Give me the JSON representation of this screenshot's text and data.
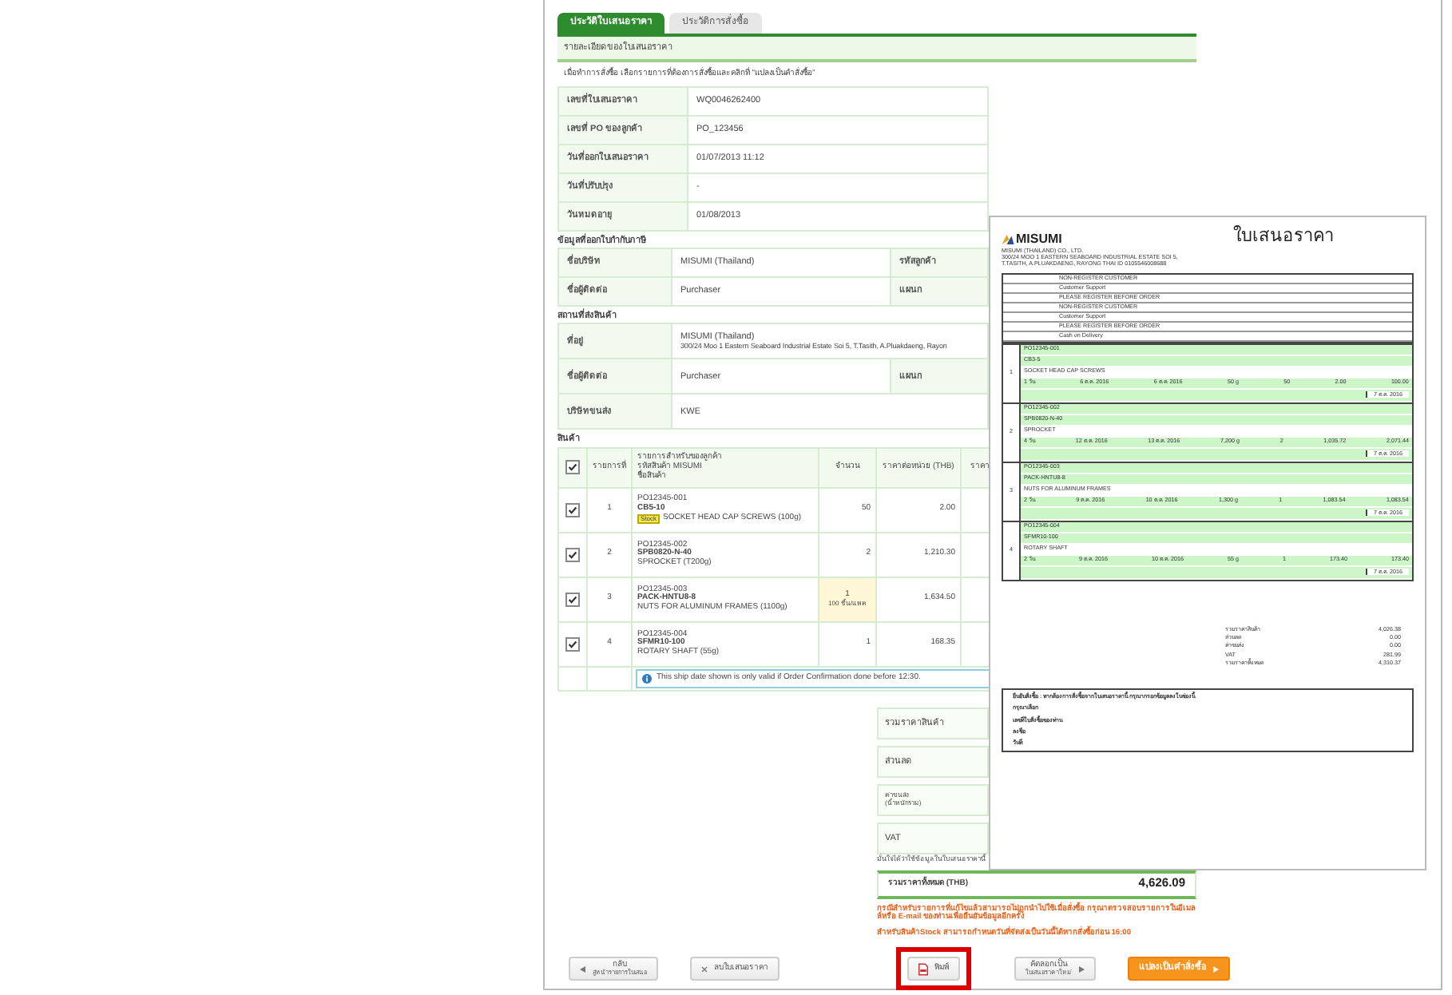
{
  "tabs": [
    {
      "label": "ประวัติใบเสนอราคา",
      "selected": true
    },
    {
      "label": "ประวัติการสั่งซื้อ",
      "selected": false
    }
  ],
  "section_title": "รายละเอียดของใบเสนอราคา",
  "note": "เมื่อทำการสั่งซื้อ เลือกรายการที่ต้องการสั่งซื้อและคลิกที่ \"แปลงเป็นคำสั่งซื้อ\"",
  "quote_info": [
    {
      "label": "เลขที่ใบเสนอราคา",
      "value": "WQ0046262400"
    },
    {
      "label": "เลขที่ PO ของลูกค้า",
      "value": "PO_123456"
    },
    {
      "label": "วันที่ออกใบเสนอราคา",
      "value": "01/07/2013 11:12"
    },
    {
      "label": "วันที่ปรับปรุง",
      "value": "-"
    },
    {
      "label": "วันหมดอายุ",
      "value": "01/08/2013"
    }
  ],
  "billing": {
    "title": "ข้อมูลที่ออกใบกำกับภาษี",
    "rows": [
      {
        "label": "ชื่อบริษัท",
        "value": "MISUMI (Thailand)",
        "label_2": "รหัสลูกค้า"
      },
      {
        "label": "ชื่อผู้ติดต่อ",
        "value": "Purchaser",
        "label_2": "แผนก"
      }
    ]
  },
  "shipping": {
    "title": "สถานที่ส่งสินค้า",
    "rows": [
      {
        "label": "ที่อยู่",
        "lines": [
          "MISUMI (Thailand)",
          "300/24 Moo 1 Eastern Seaboard Industrial Estate Soi 5, T.Tasith, A.Pluakdaeng, Rayon"
        ]
      },
      {
        "label": "ชื่อผู้ติดต่อ",
        "lines": [
          "Purchaser"
        ],
        "label_2": "แผนก"
      },
      {
        "label": "บริษัทขนส่ง",
        "lines": [
          "KWE"
        ]
      }
    ]
  },
  "products": {
    "title": "สินค้า",
    "header_checked": true,
    "columns": [
      "รายการที่",
      [
        "รายการสำหรับของลูกค้า",
        "รหัสสินค้า MISUMI",
        "ชื่อสินค้า"
      ],
      "จำนวน",
      "ราคาต่อหน่วย (THB)",
      "ราคา"
    ],
    "rows": [
      {
        "checked": true,
        "no": "1",
        "po": "PO12345-001",
        "code": "CB5-10",
        "badge": "Stock",
        "name": "SOCKET HEAD CAP SCREWS (100g)",
        "qty": "50",
        "unit_price": "2.00"
      },
      {
        "checked": true,
        "no": "2",
        "po": "PO12345-002",
        "code": "SPB0820-N-40",
        "name": "SPROCKET (T200g)",
        "qty": "2",
        "unit_price": "1,210.30"
      },
      {
        "checked": true,
        "no": "3",
        "po": "PO12345-003",
        "code": "PACK-HNTU8-8",
        "name": "NUTS FOR ALUMINUM FRAMES (1100g)",
        "qty": "1",
        "qty_note": "100 ชิ้น/แพค",
        "unit_price": "1,634.50"
      },
      {
        "checked": true,
        "no": "4",
        "po": "PO12345-004",
        "code": "SFMR10-100",
        "name": "ROTARY SHAFT (55g)",
        "qty": "1",
        "unit_price": "168.35"
      }
    ],
    "info": "This ship date shown is only valid if Order Confirmation done before 12:30."
  },
  "summary": [
    {
      "lines": [
        "รวมราคาสินค้า"
      ]
    },
    {
      "lines": [
        "ส่วนลด"
      ]
    },
    {
      "lines": [
        "ค่าขนส่ง",
        "(น้ำหนักรวม)"
      ]
    },
    {
      "lines": [
        "VAT"
      ]
    }
  ],
  "summary_note": "มั่นใจได้ว่าใช้ข้อมูลในใบเสนอราคานี้",
  "total": {
    "label": "รวมราคาทั้งหมด (THB)",
    "value": "4,626.09"
  },
  "warnings": [
    "กรณีสำหรับรายการที่แก้ไขแล้วสามารถไม่ถูกนำไปใช้เมื่อสั่งซื้อ กรุณาตรวจสอบรายการในอีเมลล์หรือ E-mail ของท่านเพื่อยืนยันข้อมูลอีกครั้ง",
    "สำหรับสินค้าStock สามารถกำหนดวันที่จัดส่งเป็นวันนี้ได้หากสั่งซื้อก่อน 16:00"
  ],
  "buttons": [
    {
      "kind": "back",
      "label": "กลับ",
      "sub": "สู่หน้ารายการใบเสนอ"
    },
    {
      "kind": "delete",
      "label": "ลบใบเสนอราคา"
    },
    {
      "kind": "print",
      "label": "พิมพ์",
      "highlighted": true
    },
    {
      "kind": "copy",
      "label": "คัดลอกเป็น",
      "sub": "ใบเสนอราคาใหม่"
    },
    {
      "kind": "convert",
      "label": "แปลงเป็นคำสั่งซื้อ"
    }
  ],
  "preview": {
    "title": "ใบเสนอราคา",
    "logo": "MISUMI",
    "company": [
      "MISUMI (THAILAND) CO., LTD.",
      "300/24 MOO 1 EASTERN SEABOARD INDUSTRIAL ESTATE SOI 5,",
      "T.TASITH, A.PLUAKDAENG, RAYONG THAI ID 0105546008688"
    ],
    "customer_rows": [
      "NON-REGISTER CUSTOMER",
      "Customer Support",
      "PLEASE REGISTER BEFORE ORDER",
      "NON-REGISTER CUSTOMER",
      "Customer Support",
      "PLEASE REGISTER BEFORE ORDER",
      "Cash on Delivery"
    ],
    "items": [
      {
        "no": "1",
        "po": "PO12345-001",
        "code": "CB3-5",
        "name": "SOCKET HEAD CAP SCREWS",
        "cells": [
          "1 วัน",
          "6 ต.ค. 2016",
          "6 ต.ค. 2016",
          "50 g",
          "50",
          "2.00",
          "100.00"
        ],
        "ship": "7 ต.ค. 2016"
      },
      {
        "no": "2",
        "po": "PO12345-002",
        "code": "SPB0820-N-40",
        "name": "SPROCKET",
        "cells": [
          "4 วัน",
          "12 ต.ค. 2016",
          "13 ต.ค. 2016",
          "7,200 g",
          "2",
          "1,035.72",
          "2,071.44"
        ],
        "ship": "7 ต.ค. 2016"
      },
      {
        "no": "3",
        "po": "PO12345-003",
        "code": "PACK-HNTU8-8",
        "name": "NUTS FOR ALUMINUM FRAMES",
        "cells": [
          "2 วัน",
          "9 ต.ค. 2016",
          "10 ต.ค. 2016",
          "1,300 g",
          "1",
          "1,083.54",
          "1,083.54"
        ],
        "ship": "7 ต.ค. 2016"
      },
      {
        "no": "4",
        "po": "PO12345-004",
        "code": "SFMR10-100",
        "name": "ROTARY SHAFT",
        "cells": [
          "2 วัน",
          "9 ต.ค. 2016",
          "10 ต.ค. 2016",
          "55 g",
          "1",
          "173.40",
          "173.40"
        ],
        "ship": "7 ต.ค. 2016"
      }
    ],
    "totals": [
      {
        "label": "รวมราคาสินค้า",
        "value": "4,026.38"
      },
      {
        "label": "ส่วนลด",
        "value": "0.00"
      },
      {
        "label": "ค่าขนส่ง",
        "value": "0.00"
      },
      {
        "label": "VAT",
        "value": "281.99"
      },
      {
        "label": "รวมราคาทั้งหมด",
        "value": "4,310.37"
      }
    ],
    "confirm_title": "ยืนยันสั่งซื้อ : หากต้องการสั่งซื้อจากใบเสนอราคานี้ กรุณากรอกข้อมูลลงในช่องนี้",
    "confirm_fields": [
      "กรุณาเลือก",
      "เลขที่ใบสั่งซื้อของท่าน",
      "ลงชื่อ",
      "วันที่"
    ]
  }
}
